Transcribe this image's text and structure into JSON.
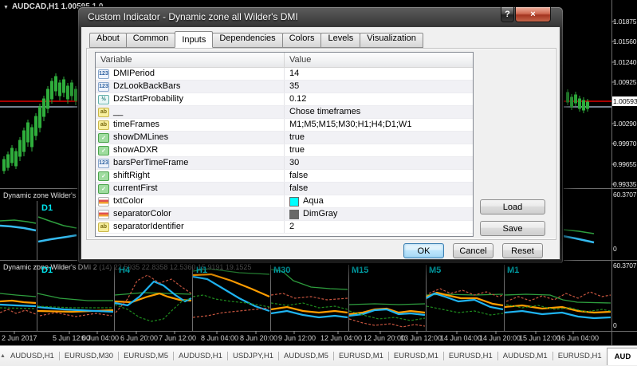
{
  "chart": {
    "header": "AUDCAD,H1  1.00595 1.0",
    "dropdown_glyph": "▼",
    "current_price": "1.00593",
    "price_axis": [
      "1.01875",
      "1.01560",
      "1.01240",
      "1.00925",
      "1.00290",
      "0.99970",
      "0.99655",
      "0.99335"
    ],
    "colors": {
      "candle": "#2fae3c",
      "price_line": "#e00000",
      "orange_line": "#ff9d00",
      "cyan_line": "#1fb3f0",
      "green_line": "#2e9e3e",
      "red_dashed": "#c7553f",
      "green_dashed": "#1e8c1e"
    }
  },
  "sub1": {
    "label": "Dynamic zone Wilder's DMI",
    "tf": "D1",
    "scale_top": "60.3707",
    "scale_bottom": "0"
  },
  "sub2": {
    "label": "Dynamic zone Wilder's DMI 2",
    "values": "(14) 22.5935 22.8358 12.5360 15.9191 19.1525",
    "scale_top": "60.3707",
    "scale_bottom": "0",
    "sections": [
      "D1",
      "H4",
      "H1",
      "M30",
      "M15",
      "M5",
      "M1"
    ]
  },
  "time_axis": [
    "2 Jun 2017",
    "5 Jun 12:00",
    "6 Jun 04:00",
    "6 Jun 20:00",
    "7 Jun 12:00",
    "8 Jun 04:00",
    "8 Jun 20:00",
    "9 Jun 12:00",
    "12 Jun 04:00",
    "12 Jun 20:00",
    "13 Jun 12:00",
    "14 Jun 04:00",
    "14 Jun 20:00",
    "15 Jun 12:00",
    "16 Jun 04:00"
  ],
  "dialog": {
    "title": "Custom Indicator - Dynamic zone all Wilder's DMI",
    "help_glyph": "?",
    "close_glyph": "×",
    "tabs": [
      "About",
      "Common",
      "Inputs",
      "Dependencies",
      "Colors",
      "Levels",
      "Visualization"
    ],
    "active_tab": "Inputs",
    "icons": {
      "int": "123",
      "double": "½",
      "string": "ab",
      "bool": "✓"
    },
    "table": {
      "headers": [
        "Variable",
        "Value"
      ],
      "rows": [
        {
          "icon": "int-icon",
          "name": "DMIPeriod",
          "value": "14"
        },
        {
          "icon": "int-icon",
          "name": "DzLookBackBars",
          "value": "35"
        },
        {
          "icon": "double-icon",
          "name": "DzStartProbability",
          "value": "0.12"
        },
        {
          "icon": "string-icon",
          "name": "__",
          "value": "Chose timeframes"
        },
        {
          "icon": "string-icon",
          "name": "timeFrames",
          "value": "M1;M5;M15;M30;H1;H4;D1;W1"
        },
        {
          "icon": "bool-icon",
          "name": "showDMLines",
          "value": "true"
        },
        {
          "icon": "bool-icon",
          "name": "showADXR",
          "value": "true"
        },
        {
          "icon": "int-icon",
          "name": "barsPerTimeFrame",
          "value": "30"
        },
        {
          "icon": "bool-icon",
          "name": "shiftRight",
          "value": "false"
        },
        {
          "icon": "bool-icon",
          "name": "currentFirst",
          "value": "false"
        },
        {
          "icon": "color-icon",
          "name": "txtColor",
          "value": "Aqua",
          "swatch": "#00ffff"
        },
        {
          "icon": "color-icon",
          "name": "separatorColor",
          "value": "DimGray",
          "swatch": "#696969"
        },
        {
          "icon": "string-icon",
          "name": "separatorIdentifier",
          "value": "2"
        }
      ]
    },
    "buttons": {
      "load": "Load",
      "save": "Save",
      "ok": "OK",
      "cancel": "Cancel",
      "reset": "Reset"
    }
  },
  "bottom_bar": {
    "tabs": [
      "AUDUSD,H1",
      "EURUSD,M30",
      "EURUSD,M5",
      "AUDUSD,H1",
      "USDJPY,H1",
      "AUDUSD,M5",
      "EURUSD,M1",
      "EURUSD,M1",
      "EURUSD,H1",
      "AUDUSD,M1",
      "EURUSD,H1"
    ],
    "active_tab": "AUD",
    "scroll_left_glyph": "◄",
    "scroll_right_glyph": "►",
    "corner_glyph": "▲"
  }
}
